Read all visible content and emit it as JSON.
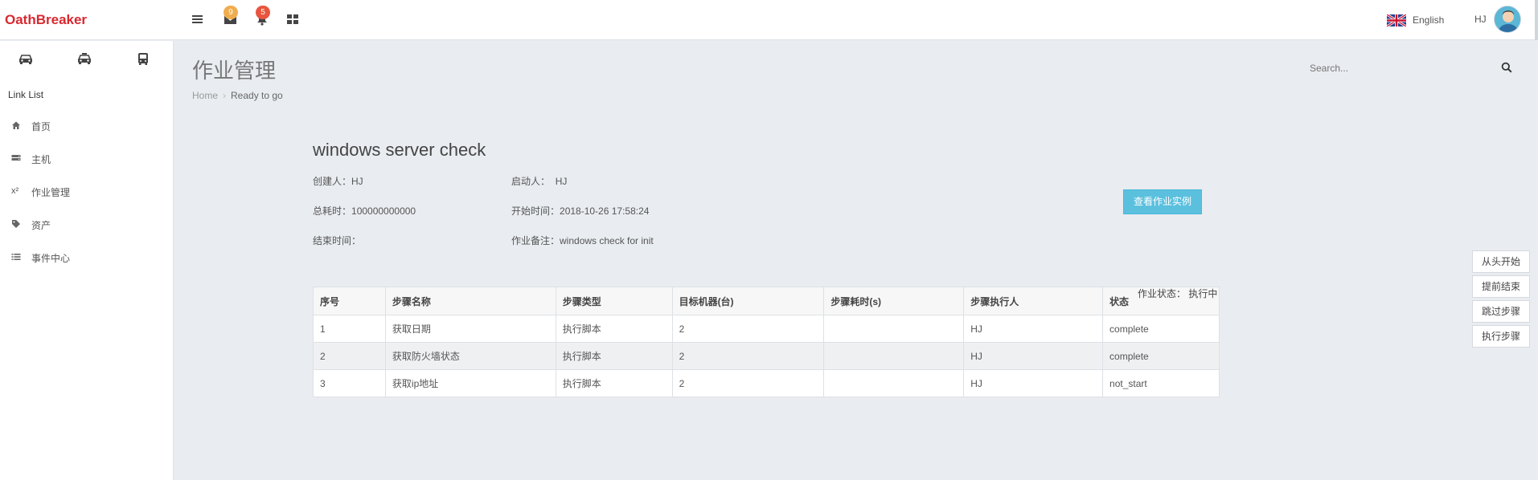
{
  "app": {
    "brand": "OathBreaker",
    "badges": {
      "mail": "9",
      "bell": "5"
    },
    "language": "English",
    "user": "HJ"
  },
  "sidebar": {
    "link_list": "Link List",
    "items": [
      {
        "label": "首页",
        "icon": "home-icon"
      },
      {
        "label": "主机",
        "icon": "server-icon"
      },
      {
        "label": "作业管理",
        "icon": "superscript-icon"
      },
      {
        "label": "资产",
        "icon": "tag-icon"
      },
      {
        "label": "事件中心",
        "icon": "list-icon"
      }
    ]
  },
  "header": {
    "title": "作业管理",
    "breadcrumb": {
      "home": "Home",
      "current": "Ready to go"
    },
    "search_placeholder": "Search..."
  },
  "job": {
    "name": "windows server check",
    "creator_label": "创建人：",
    "creator": "HJ",
    "starter_label": "启动人：",
    "starter": "HJ",
    "total_label": "总耗时：",
    "total": "100000000000",
    "start_label": "开始时间：",
    "start": "2018-10-26 17:58:24",
    "end_label": "结束时间：",
    "end": "",
    "note_label": "作业备注：",
    "note": "windows check for init",
    "view_instance": "查看作业实例",
    "status_label": "作业状态：",
    "status": "执行中"
  },
  "table": {
    "headers": [
      "序号",
      "步骤名称",
      "步骤类型",
      "目标机器(台)",
      "步骤耗时(s)",
      "步骤执行人",
      "状态"
    ],
    "rows": [
      [
        "1",
        "获取日期",
        "执行脚本",
        "2",
        "",
        "HJ",
        "complete"
      ],
      [
        "2",
        "获取防火墙状态",
        "执行脚本",
        "2",
        "",
        "HJ",
        "complete"
      ],
      [
        "3",
        "获取ip地址",
        "执行脚本",
        "2",
        "",
        "HJ",
        "not_start"
      ]
    ]
  },
  "actions": [
    "从头开始",
    "提前结束",
    "跳过步骤",
    "执行步骤"
  ],
  "colors": {
    "brand": "#d9282f",
    "primary_button": "#5bc0de",
    "badge_mail": "#f0ad4e",
    "badge_bell": "#e8553e"
  }
}
